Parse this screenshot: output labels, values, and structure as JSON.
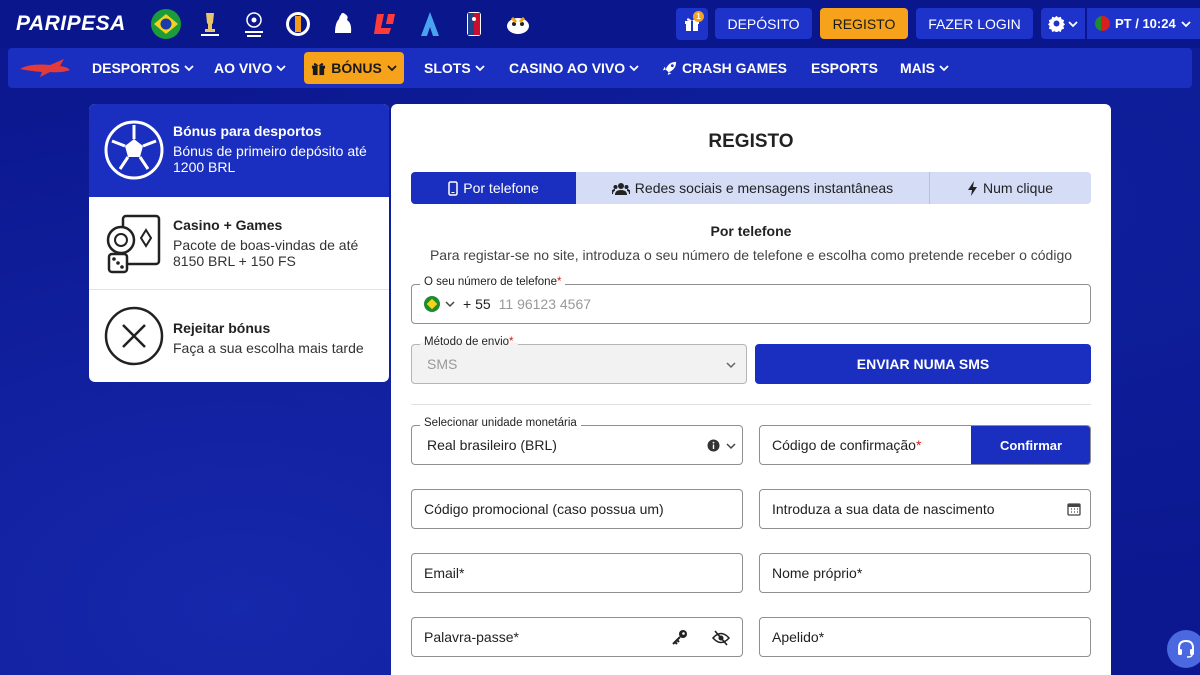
{
  "header": {
    "logo": "PARIPESA",
    "gift_badge": "1",
    "deposit_label": "DEPÓSITO",
    "register_label": "REGISTO",
    "login_label": "FAZER LOGIN",
    "lang_time": "PT / 10:24"
  },
  "nav": {
    "items": [
      "DESPORTOS",
      "AO VIVO",
      "BÓNUS",
      "SLOTS",
      "CASINO AO VIVO",
      "CRASH GAMES",
      "ESPORTS",
      "MAIS"
    ]
  },
  "bonus_panel": {
    "items": [
      {
        "title": "Bónus para desportos",
        "desc": "Bónus de primeiro depósito até 1200 BRL"
      },
      {
        "title": "Casino + Games",
        "desc": "Pacote de boas-vindas de até 8150 BRL + 150 FS"
      },
      {
        "title": "Rejeitar bónus",
        "desc": "Faça a sua escolha mais tarde"
      }
    ]
  },
  "registration": {
    "title": "REGISTO",
    "tabs": [
      "Por telefone",
      "Redes sociais e mensagens instantâneas",
      "Num clique"
    ],
    "subtitle": "Por telefone",
    "description": "Para registar-se no site, introduza o seu número de telefone e escolha como pretende receber o código",
    "phone_label": "O seu número de telefone",
    "phone_code": "+ 55",
    "phone_placeholder": "11 96123 4567",
    "method_label": "Método de envio",
    "method_value": "SMS",
    "send_sms_label": "ENVIAR NUMA SMS",
    "currency_label": "Selecionar unidade monetária",
    "currency_value": "Real brasileiro (BRL)",
    "confirm_code_label": "Código de confirmação",
    "confirm_button": "Confirmar",
    "promo_placeholder": "Código promocional (caso possua um)",
    "birth_placeholder": "Introduza a sua data de nascimento",
    "email_label": "Email",
    "first_name_label": "Nome próprio",
    "password_label": "Palavra-passe",
    "surname_label": "Apelido",
    "required_mark": "*"
  },
  "colors": {
    "primary": "#1a2fbf",
    "accent": "#f6a21a",
    "background": "#0b1890"
  }
}
